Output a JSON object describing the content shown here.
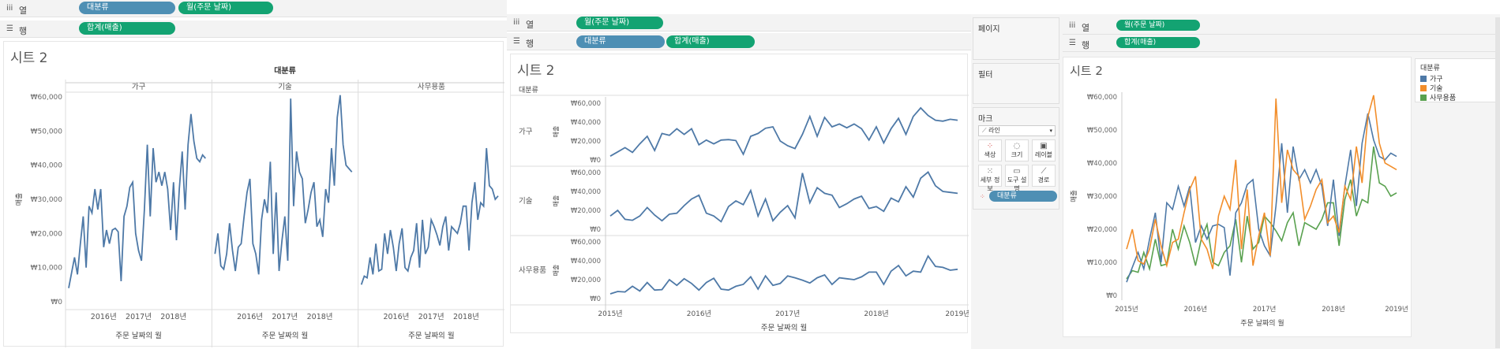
{
  "shelves": {
    "columns_label": "열",
    "rows_label": "행",
    "pill_category": "대분류",
    "pill_month": "월(주문 날짜)",
    "pill_sales": "합계(매출)"
  },
  "sheet_title": "시트 2",
  "header_category": "대분류",
  "categories": [
    "가구",
    "기술",
    "사무용품"
  ],
  "x_axis_title": "주문 날짜의 월",
  "y_axis_title": "매출",
  "years_short": [
    "2016년",
    "2017년",
    "2018년"
  ],
  "years_full": [
    "2015년",
    "2016년",
    "2017년",
    "2018년",
    "2019년"
  ],
  "side": {
    "pages_label": "페이지",
    "filters_label": "필터",
    "marks_label": "마크",
    "mark_type": "라인",
    "mark_buttons": [
      "색상",
      "크기",
      "레이블",
      "세부 정보",
      "도구 설명",
      "경로"
    ],
    "color_pill": "대분류"
  },
  "legend": {
    "title": "대분류",
    "items": [
      "가구",
      "기술",
      "사무용품"
    ]
  },
  "colors": {
    "tableau_blue": "#4e79a7",
    "tableau_orange": "#f28e2b",
    "tableau_green": "#59a14f",
    "pill_blue": "#4e8fb4",
    "pill_green": "#13a372"
  },
  "chart_data": [
    {
      "type": "line",
      "title": "시트 2",
      "layout_description": "small multiples by column",
      "x_unit": "month",
      "x_start": "2015-01",
      "ylim": [
        0,
        60000
      ],
      "y_ticks": [
        "₩0",
        "₩10,000",
        "₩20,000",
        "₩30,000",
        "₩40,000",
        "₩50,000",
        "₩60,000"
      ],
      "series": [
        {
          "name": "가구",
          "values": [
            4000,
            8500,
            13000,
            8000,
            17000,
            25000,
            10000,
            28000,
            26000,
            33000,
            27000,
            33000,
            16000,
            21000,
            17000,
            21000,
            21500,
            20500,
            6000,
            25000,
            28000,
            33500,
            35000,
            20000,
            15000,
            12000,
            27000,
            46000,
            25000,
            45000,
            35000,
            38000,
            34000,
            38000,
            33000,
            21000,
            35000,
            18000,
            33000,
            44000,
            27000,
            46000,
            55000,
            47000,
            42000,
            41000,
            43000,
            42000
          ]
        },
        {
          "name": "기술",
          "values": [
            14000,
            20000,
            10500,
            9500,
            14000,
            23000,
            15000,
            9000,
            16000,
            17000,
            25000,
            32000,
            36000,
            17000,
            14000,
            8000,
            24000,
            30000,
            26000,
            41000,
            14000,
            32000,
            9000,
            18000,
            25000,
            12000,
            59500,
            28000,
            44000,
            38000,
            36000,
            23000,
            27000,
            32000,
            35000,
            22000,
            24000,
            19000,
            33000,
            29000,
            45000,
            34000,
            54000,
            60500,
            46000,
            40000,
            39000,
            38000
          ]
        },
        {
          "name": "사무용품",
          "values": [
            5000,
            7500,
            7000,
            13000,
            8000,
            17000,
            9000,
            9500,
            20000,
            14000,
            21000,
            16000,
            9000,
            17000,
            21500,
            10000,
            9000,
            13000,
            15000,
            23000,
            10000,
            24000,
            14000,
            16000,
            24000,
            22000,
            19500,
            16500,
            22000,
            25000,
            15000,
            22000,
            21000,
            20000,
            23000,
            28000,
            28000,
            15000,
            29000,
            35000,
            24000,
            29000,
            28000,
            45000,
            34000,
            33000,
            30000,
            31000
          ]
        }
      ]
    },
    {
      "type": "line",
      "title": "시트 2",
      "layout_description": "rows by category",
      "x_unit": "month",
      "x_start": "2015-01",
      "ylim": [
        0,
        60000
      ],
      "y_ticks": [
        "₩0",
        "₩20,000",
        "₩40,000",
        "₩60,000"
      ]
    },
    {
      "type": "line",
      "title": "시트 2",
      "layout_description": "overlaid with legend",
      "x_unit": "month",
      "x_start": "2015-01",
      "ylim": [
        0,
        60000
      ],
      "y_ticks": [
        "₩0",
        "₩10,000",
        "₩20,000",
        "₩30,000",
        "₩40,000",
        "₩50,000",
        "₩60,000"
      ]
    }
  ]
}
